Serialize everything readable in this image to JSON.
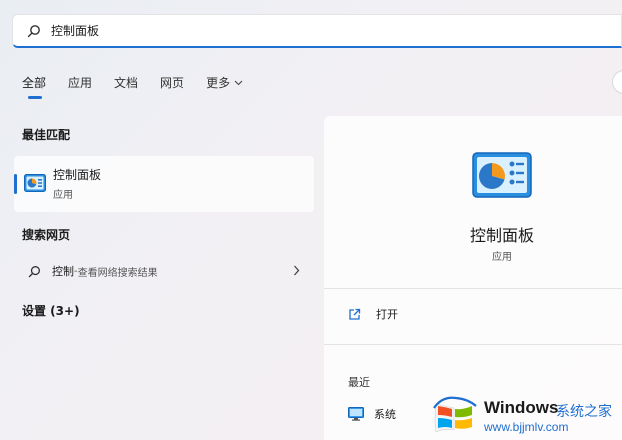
{
  "search": {
    "value": "控制面板",
    "icon": "search-icon"
  },
  "tabs": [
    {
      "label": "全部",
      "active": true
    },
    {
      "label": "应用",
      "active": false
    },
    {
      "label": "文档",
      "active": false
    },
    {
      "label": "网页",
      "active": false
    }
  ],
  "tab_more": {
    "label": "更多",
    "icon": "chevron-down-icon"
  },
  "best_match": {
    "title": "最佳匹配",
    "name": "控制面板",
    "type": "应用",
    "icon": "control-panel-icon"
  },
  "web_search": {
    "title": "搜索网页",
    "query": "控制",
    "separator": " - ",
    "hint": "查看网络搜索结果",
    "icon": "search-icon"
  },
  "settings": {
    "title": "设置 (3+)"
  },
  "detail": {
    "name": "控制面板",
    "type": "应用",
    "open_label": "打开",
    "open_icon": "open-external-icon",
    "recent_title": "最近",
    "recent_items": [
      {
        "label": "系统",
        "icon": "system-monitor-icon"
      }
    ]
  },
  "watermark": {
    "brand": "Windows",
    "site": "系统之家",
    "url": "www.bjjmlv.com"
  },
  "colors": {
    "accent": "#1f6fd1",
    "panel": "#ffffff",
    "background": "#eef0f4"
  }
}
